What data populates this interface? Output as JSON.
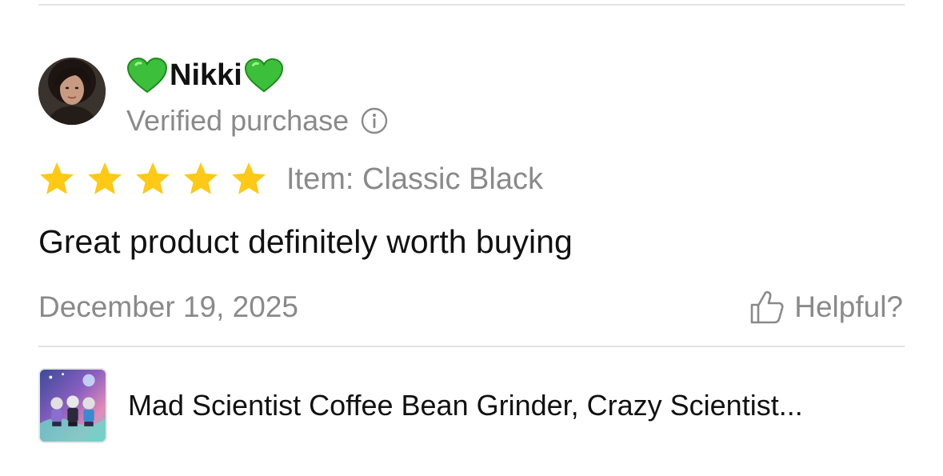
{
  "review": {
    "reviewer_name": "Nikki",
    "name_decoration_icon": "green-heart-emoji",
    "verified_label": "Verified purchase",
    "rating": 5,
    "rating_max": 5,
    "item_label": "Item: Classic Black",
    "text": "Great product definitely worth buying",
    "date": "December 19, 2025",
    "helpful_label": "Helpful?"
  },
  "product": {
    "title": "Mad Scientist Coffee Bean Grinder, Crazy Scientist..."
  },
  "colors": {
    "star": "#FFC915",
    "heart": "#3CBF3A",
    "muted_text": "#8a8a8a",
    "divider": "#e3e3e3"
  }
}
